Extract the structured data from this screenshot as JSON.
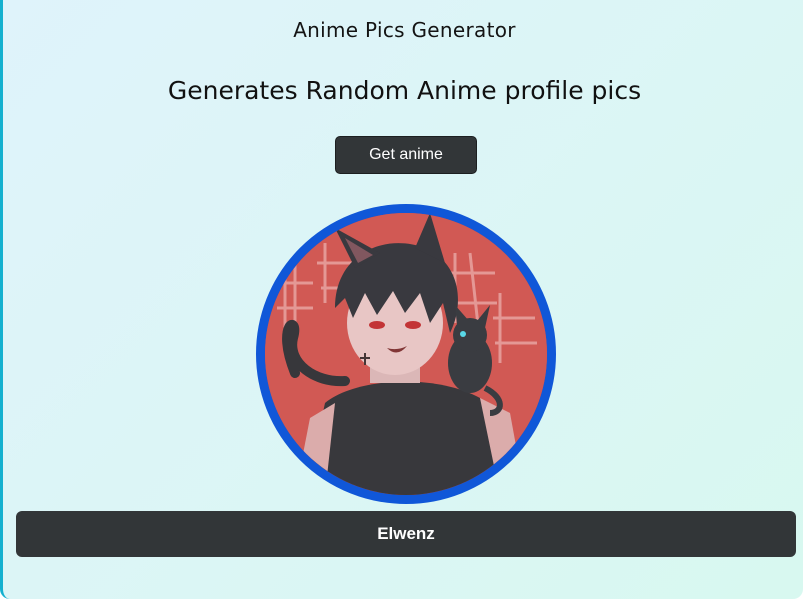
{
  "app": {
    "title": "Anime Pics Generator",
    "heading": "Generates Random Anime profile pics"
  },
  "actions": {
    "get_label": "Get anime"
  },
  "result": {
    "image_subject": "anime-character-avatar",
    "artist_name": "Elwenz"
  },
  "colors": {
    "ring": "#1057d8",
    "button_bg": "#323638",
    "card_border": "#14b0cf",
    "card_gradient_start": "#dff3fb",
    "card_gradient_end": "#d8f8f0"
  }
}
